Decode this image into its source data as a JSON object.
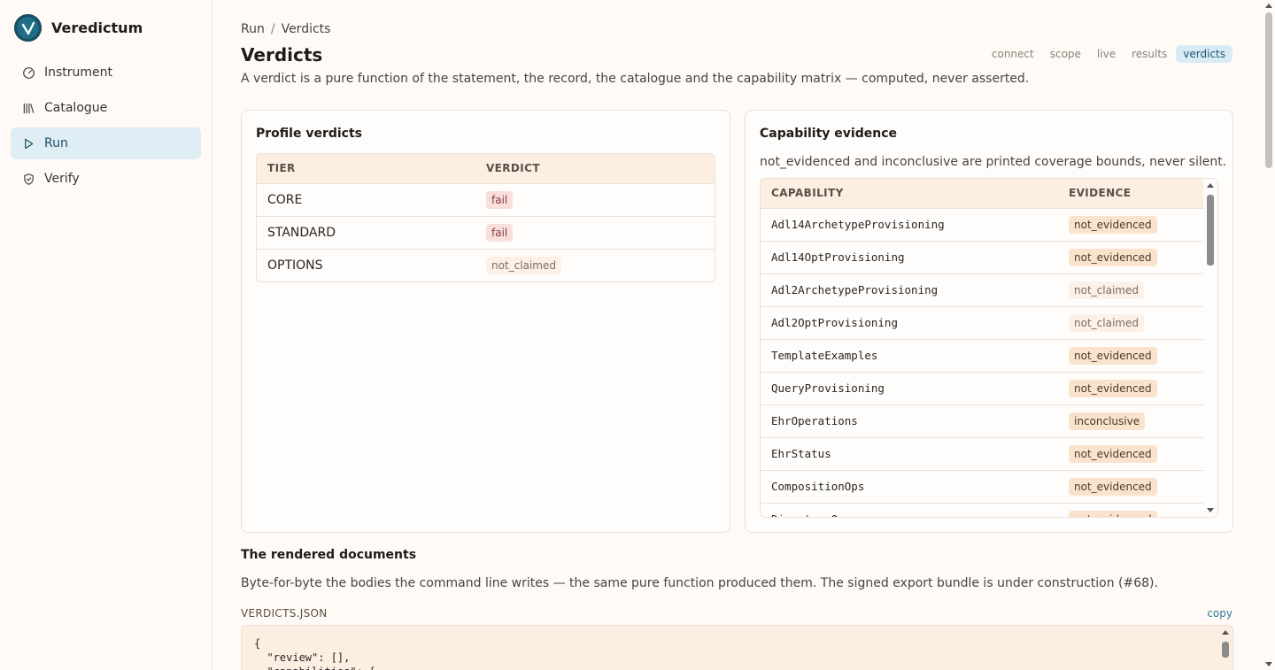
{
  "brand": {
    "name": "Veredictum"
  },
  "nav": [
    {
      "label": "Instrument",
      "icon": "gauge-icon"
    },
    {
      "label": "Catalogue",
      "icon": "library-icon"
    },
    {
      "label": "Run",
      "icon": "play-icon",
      "active": true
    },
    {
      "label": "Verify",
      "icon": "shield-check-icon"
    }
  ],
  "breadcrumb": {
    "parent": "Run",
    "sep": "/",
    "current": "Verdicts"
  },
  "page": {
    "title": "Verdicts",
    "lede": "A verdict is a pure function of the statement, the record, the catalogue and the capability matrix — computed, never asserted."
  },
  "steps": [
    "connect",
    "scope",
    "live",
    "results",
    "verdicts"
  ],
  "profile": {
    "title": "Profile verdicts",
    "headers": [
      "TIER",
      "VERDICT"
    ],
    "rows": [
      {
        "tier": "CORE",
        "verdict": "fail"
      },
      {
        "tier": "STANDARD",
        "verdict": "fail"
      },
      {
        "tier": "OPTIONS",
        "verdict": "not_claimed"
      }
    ]
  },
  "capability": {
    "title": "Capability evidence",
    "note": "not_evidenced and inconclusive are printed coverage bounds, never silent.",
    "headers": [
      "CAPABILITY",
      "EVIDENCE"
    ],
    "rows": [
      {
        "cap": "Adl14ArchetypeProvisioning",
        "ev": "not_evidenced"
      },
      {
        "cap": "Adl14OptProvisioning",
        "ev": "not_evidenced"
      },
      {
        "cap": "Adl2ArchetypeProvisioning",
        "ev": "not_claimed"
      },
      {
        "cap": "Adl2OptProvisioning",
        "ev": "not_claimed"
      },
      {
        "cap": "TemplateExamples",
        "ev": "not_evidenced"
      },
      {
        "cap": "QueryProvisioning",
        "ev": "not_evidenced"
      },
      {
        "cap": "EhrOperations",
        "ev": "inconclusive"
      },
      {
        "cap": "EhrStatus",
        "ev": "not_evidenced"
      },
      {
        "cap": "CompositionOps",
        "ev": "not_evidenced"
      },
      {
        "cap": "DirectoryOps",
        "ev": "not_evidenced"
      }
    ]
  },
  "rendered": {
    "title": "The rendered documents",
    "desc": "Byte-for-byte the bodies the command line writes — the same pure function produced them. The signed export bundle is under construction (#68).",
    "file_label": "VERDICTS.JSON",
    "copy_label": "copy",
    "code": "{\n  \"review\": [],\n  \"capabilities\": ["
  }
}
